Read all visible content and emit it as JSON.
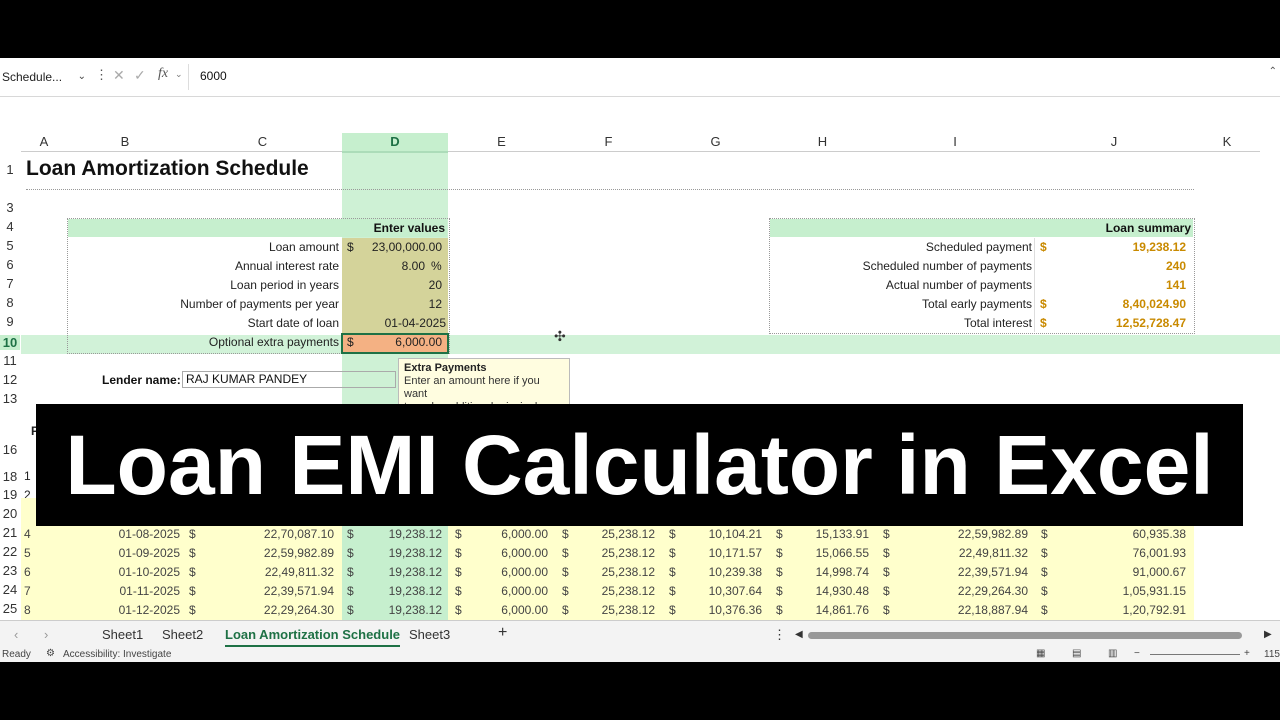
{
  "formula_bar": {
    "name_box": "Schedule...",
    "formula_value": "6000"
  },
  "columns": [
    "A",
    "B",
    "C",
    "D",
    "E",
    "F",
    "G",
    "H",
    "I",
    "J",
    "K"
  ],
  "rows": [
    "1",
    "3",
    "4",
    "5",
    "6",
    "7",
    "8",
    "9",
    "10",
    "11",
    "12",
    "13",
    "16",
    "18",
    "19",
    "20",
    "21",
    "22",
    "23",
    "24",
    "25"
  ],
  "title": "Loan Amortization Schedule",
  "enter_values": {
    "header": "Enter values",
    "labels": [
      "Loan amount",
      "Annual interest rate",
      "Loan period in years",
      "Number of payments per year",
      "Start date of loan",
      "Optional extra payments"
    ],
    "currency": "$",
    "values": [
      "23,00,000.00",
      "8.00",
      "20",
      "12",
      "01-04-2025",
      "6,000.00"
    ],
    "pct": "%"
  },
  "lender": {
    "label": "Lender name:",
    "value": "RAJ KUMAR PANDEY"
  },
  "tooltip": {
    "title": "Extra Payments",
    "line1": "Enter an amount here if you want",
    "line2": "to make additional principal"
  },
  "summary": {
    "header": "Loan summary",
    "labels": [
      "Scheduled payment",
      "Scheduled number of payments",
      "Actual number of payments",
      "Total early payments",
      "Total interest"
    ],
    "values": [
      "19,238.12",
      "240",
      "141",
      "8,40,024.90",
      "12,52,728.47"
    ]
  },
  "table_rows": [
    {
      "n": "4",
      "date": "01-08-2025",
      "beg": "22,70,087.10",
      "pay": "19,238.12",
      "extra": "6,000.00",
      "total": "25,238.12",
      "prin": "10,104.21",
      "int": "15,133.91",
      "end": "22,59,982.89",
      "cum": "60,935.38"
    },
    {
      "n": "5",
      "date": "01-09-2025",
      "beg": "22,59,982.89",
      "pay": "19,238.12",
      "extra": "6,000.00",
      "total": "25,238.12",
      "prin": "10,171.57",
      "int": "15,066.55",
      "end": "22,49,811.32",
      "cum": "76,001.93"
    },
    {
      "n": "6",
      "date": "01-10-2025",
      "beg": "22,49,811.32",
      "pay": "19,238.12",
      "extra": "6,000.00",
      "total": "25,238.12",
      "prin": "10,239.38",
      "int": "14,998.74",
      "end": "22,39,571.94",
      "cum": "91,000.67"
    },
    {
      "n": "7",
      "date": "01-11-2025",
      "beg": "22,39,571.94",
      "pay": "19,238.12",
      "extra": "6,000.00",
      "total": "25,238.12",
      "prin": "10,307.64",
      "int": "14,930.48",
      "end": "22,29,264.30",
      "cum": "1,05,931.15"
    },
    {
      "n": "8",
      "date": "01-12-2025",
      "beg": "22,29,264.30",
      "pay": "19,238.12",
      "extra": "6,000.00",
      "total": "25,238.12",
      "prin": "10,376.36",
      "int": "14,861.76",
      "end": "22,18,887.94",
      "cum": "1,20,792.91"
    }
  ],
  "partial_rows": [
    "1",
    "2",
    "3"
  ],
  "sheets": [
    "Sheet1",
    "Sheet2",
    "Loan Amortization Schedule",
    "Sheet3"
  ],
  "add_sheet": "+",
  "status": {
    "ready": "Ready",
    "accessibility": "Accessibility: Investigate",
    "zoom": "115"
  },
  "banner": "Loan EMI Calculator in Excel",
  "header_partial": "P"
}
